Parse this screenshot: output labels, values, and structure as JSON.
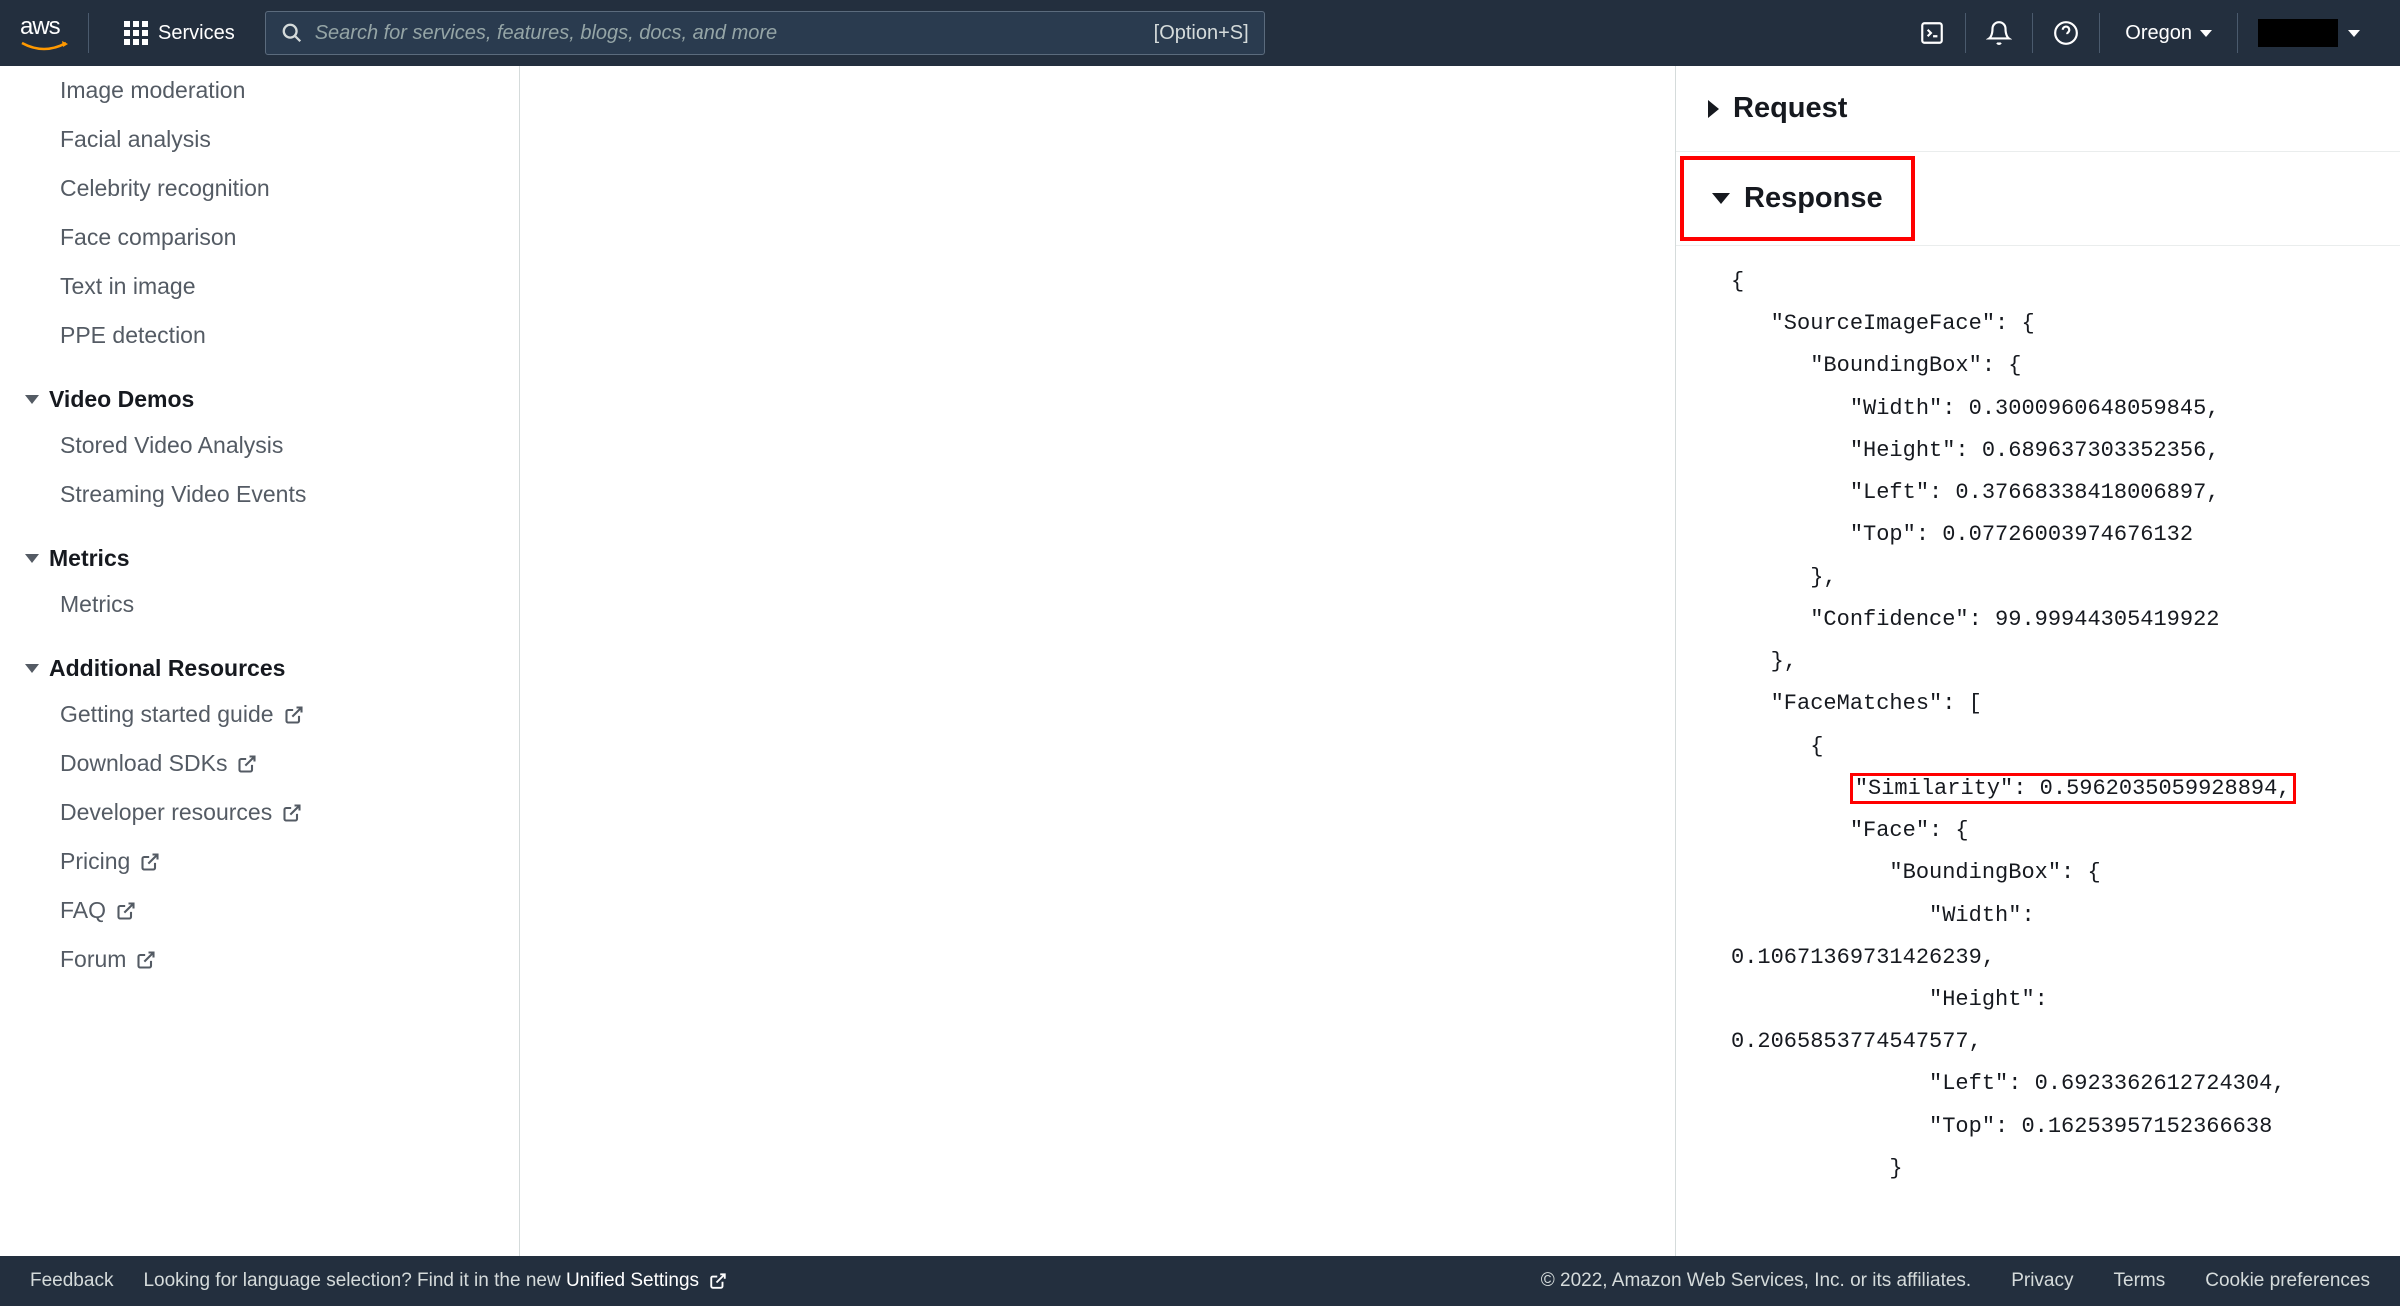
{
  "nav": {
    "services_label": "Services",
    "search_placeholder": "Search for services, features, blogs, docs, and more",
    "search_shortcut": "[Option+S]",
    "region": "Oregon"
  },
  "sidebar": {
    "items_top": [
      "Image moderation",
      "Facial analysis",
      "Celebrity recognition",
      "Face comparison",
      "Text in image",
      "PPE detection"
    ],
    "group_video": "Video Demos",
    "items_video": [
      "Stored Video Analysis",
      "Streaming Video Events"
    ],
    "group_metrics": "Metrics",
    "items_metrics": [
      "Metrics"
    ],
    "group_resources": "Additional Resources",
    "items_resources": [
      "Getting started guide",
      "Download SDKs",
      "Developer resources",
      "Pricing",
      "FAQ",
      "Forum"
    ]
  },
  "panel": {
    "request_label": "Request",
    "response_label": "Response",
    "response_body": {
      "line1": "{",
      "line2": "   \"SourceImageFace\": {",
      "line3": "      \"BoundingBox\": {",
      "line4": "         \"Width\": 0.3000960648059845,",
      "line5": "         \"Height\": 0.689637303352356,",
      "line6": "         \"Left\": 0.37668338418006897,",
      "line7": "         \"Top\": 0.07726003974676132",
      "line8": "      },",
      "line9": "      \"Confidence\": 99.99944305419922",
      "line10": "   },",
      "line11": "   \"FaceMatches\": [",
      "line12": "      {",
      "line13p": "         ",
      "line13": "\"Similarity\": 0.5962035059928894,",
      "line14": "         \"Face\": {",
      "line15": "            \"BoundingBox\": {",
      "line16": "               \"Width\": ",
      "line16b": "0.10671369731426239,",
      "line17": "               \"Height\": ",
      "line17b": "0.2065853774547577,",
      "line18": "               \"Left\": 0.6923362612724304,",
      "line19": "               \"Top\": 0.16253957152366638",
      "line20": "            }"
    }
  },
  "footer": {
    "feedback": "Feedback",
    "lang_msg": "Looking for language selection? Find it in the new ",
    "lang_link": "Unified Settings",
    "copyright": "© 2022, Amazon Web Services, Inc. or its affiliates.",
    "privacy": "Privacy",
    "terms": "Terms",
    "cookie": "Cookie preferences"
  }
}
